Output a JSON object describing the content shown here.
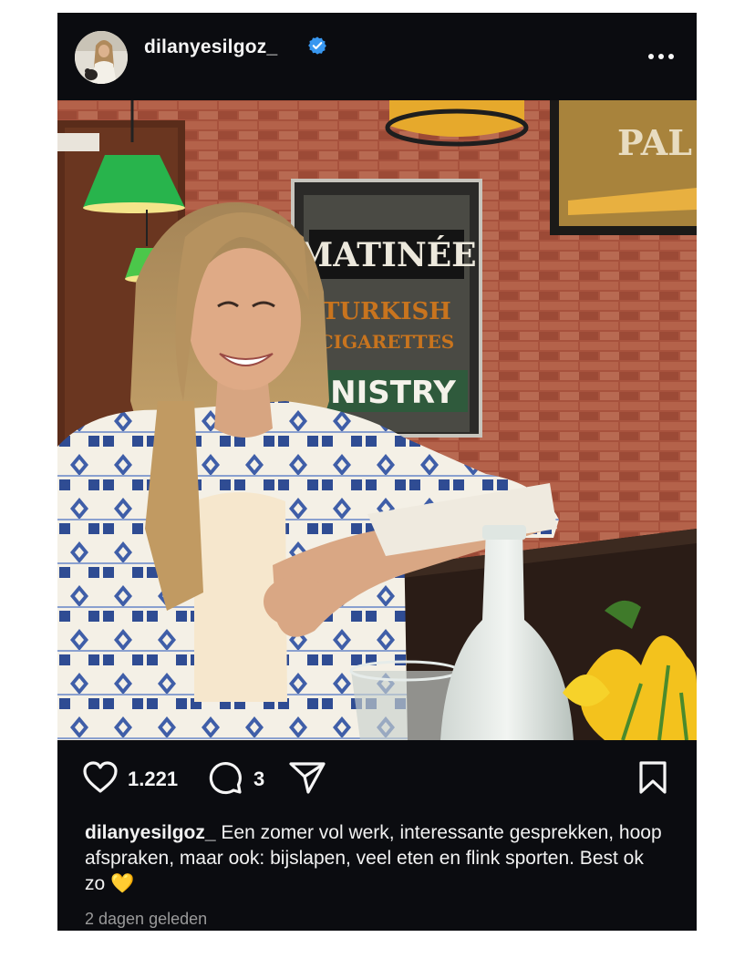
{
  "post": {
    "username": "dilanyesilgoz_",
    "verified": true,
    "photo_sign": {
      "line1": "MATINÉE",
      "line2": "TURKISH",
      "line3": "CIGARETTES",
      "line4": "NISTRY",
      "framed": "PAL"
    },
    "likes": "1.221",
    "comments": "3",
    "caption_text": "Een zomer vol werk, interessante gesprekken, hoop afspraken, maar ook: bijslapen, veel eten en flink sporten. Best ok zo 💛",
    "timestamp": "2 dagen geleden"
  },
  "colors": {
    "background": "#0b0c10",
    "text": "#f5f5f5",
    "muted": "#9a9a9a",
    "verified_blue": "#3897f0",
    "heart_emoji": "#f7c531"
  },
  "icons": [
    "avatar",
    "verified-badge-icon",
    "more-options-icon",
    "heart-icon",
    "comment-icon",
    "share-icon",
    "bookmark-icon"
  ]
}
